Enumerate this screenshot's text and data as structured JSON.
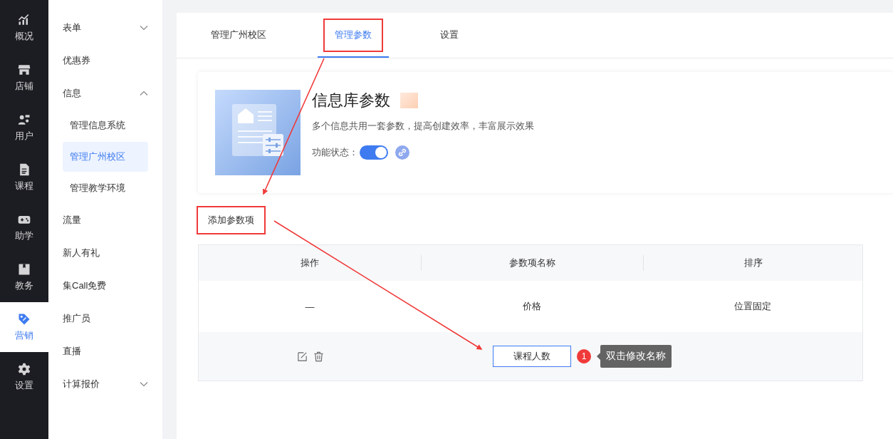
{
  "nav_rail": [
    {
      "label": "概况",
      "selected": false
    },
    {
      "label": "店铺",
      "selected": false
    },
    {
      "label": "用户",
      "selected": false
    },
    {
      "label": "课程",
      "selected": false
    },
    {
      "label": "助学",
      "selected": false
    },
    {
      "label": "教务",
      "selected": false
    },
    {
      "label": "营销",
      "selected": true
    },
    {
      "label": "设置",
      "selected": false
    }
  ],
  "sidebar": {
    "items": [
      {
        "label": "表单",
        "expanded": false,
        "selected": false
      },
      {
        "label": "优惠券",
        "selected": false
      },
      {
        "label": "信息",
        "expanded": true,
        "selected": false,
        "children": [
          {
            "label": "管理信息系统",
            "selected": false
          },
          {
            "label": "管理广州校区",
            "selected": true
          },
          {
            "label": "管理教学环境",
            "selected": false
          }
        ]
      },
      {
        "label": "流量",
        "selected": false
      },
      {
        "label": "新人有礼",
        "selected": false
      },
      {
        "label": "集Call免费",
        "selected": false
      },
      {
        "label": "推广员",
        "selected": false
      },
      {
        "label": "直播",
        "selected": false
      },
      {
        "label": "计算报价",
        "expanded": false,
        "selected": false
      }
    ]
  },
  "tabs": [
    {
      "label": "管理广州校区",
      "selected": false,
      "highlighted": false
    },
    {
      "label": "管理参数",
      "selected": true,
      "highlighted": true
    },
    {
      "label": "设置",
      "selected": false,
      "highlighted": false
    }
  ],
  "feature_card": {
    "title": "信息库参数",
    "description": "多个信息共用一套参数，提高创建效率，丰富展示效果",
    "status_label": "功能状态：",
    "enabled": true
  },
  "add_button": {
    "label": "添加参数项",
    "highlighted": true
  },
  "table": {
    "columns": [
      "操作",
      "参数项名称",
      "排序"
    ],
    "rows": [
      {
        "kind": "fixed",
        "action": "—",
        "name": "价格",
        "order": "位置固定"
      },
      {
        "kind": "editable",
        "name": "课程人数",
        "badge": "1",
        "tooltip": "双击修改名称"
      }
    ]
  }
}
